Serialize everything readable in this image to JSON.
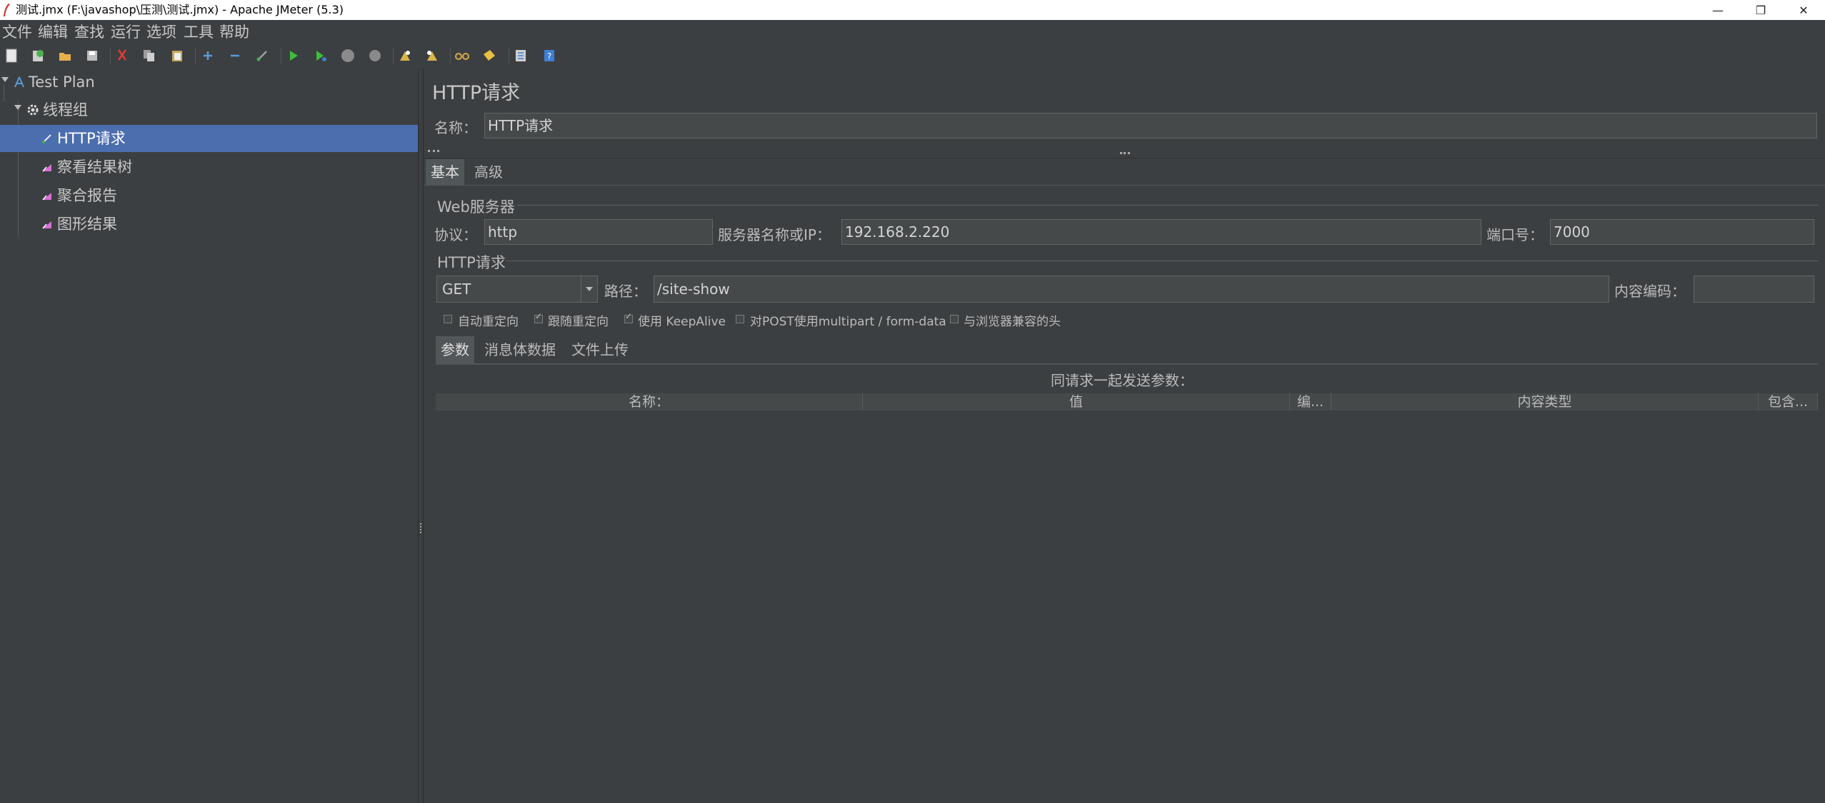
{
  "window": {
    "title": "测试.jmx (F:\\javashop\\压测\\测试.jmx) - Apache JMeter (5.3)",
    "minimize": "—",
    "restore": "❐",
    "close": "✕"
  },
  "menu": [
    "文件",
    "编辑",
    "查找",
    "运行",
    "选项",
    "工具",
    "帮助"
  ],
  "toolbar": [
    {
      "icon": "new-icon",
      "color": "#e0e0e0"
    },
    {
      "icon": "templates-icon",
      "color": "#4caf50"
    },
    {
      "icon": "open-icon",
      "color": "#e8b04a"
    },
    {
      "icon": "save-icon",
      "color": "#cccccc"
    },
    {
      "icon": "cut-icon",
      "color": "#e53935"
    },
    {
      "icon": "copy-icon",
      "color": "#cccccc"
    },
    {
      "icon": "paste-icon",
      "color": "#e8c86a"
    },
    {
      "icon": "expand-icon",
      "color": "#5b9bd5"
    },
    {
      "icon": "collapse-icon",
      "color": "#5b9bd5"
    },
    {
      "icon": "toggle-icon",
      "color": "#9e9e9e"
    },
    {
      "icon": "start-icon",
      "color": "#3cbd3c"
    },
    {
      "icon": "start-no-pause-icon",
      "color": "#3cbd3c"
    },
    {
      "icon": "stop-icon",
      "color": "#8a8a8a"
    },
    {
      "icon": "shutdown-icon",
      "color": "#8a8a8a"
    },
    {
      "icon": "clear-icon",
      "color": "#d9b44a"
    },
    {
      "icon": "clear-all-icon",
      "color": "#d9b44a"
    },
    {
      "icon": "search-icon",
      "color": "#d4a84a"
    },
    {
      "icon": "reset-search-icon",
      "color": "#e8c040"
    },
    {
      "icon": "function-helper-icon",
      "color": "#cccccc"
    },
    {
      "icon": "help-icon",
      "color": "#3d7ed6"
    }
  ],
  "tree": [
    {
      "label": "Test Plan",
      "icon": "test-plan-icon",
      "level": 0,
      "expanded": true
    },
    {
      "label": "线程组",
      "icon": "thread-group-icon",
      "level": 1,
      "expanded": true
    },
    {
      "label": "HTTP请求",
      "icon": "sampler-icon",
      "level": 2,
      "selected": true
    },
    {
      "label": "察看结果树",
      "icon": "listener-icon",
      "level": 2
    },
    {
      "label": "聚合报告",
      "icon": "listener-icon",
      "level": 2
    },
    {
      "label": "图形结果",
      "icon": "listener-icon",
      "level": 2
    }
  ],
  "panel": {
    "title": "HTTP请求",
    "name_label": "名称：",
    "name_value": "HTTP请求",
    "tabs": [
      "基本",
      "高级"
    ],
    "web_server_label": "Web服务器",
    "protocol_label": "协议：",
    "protocol_value": "http",
    "server_label": "服务器名称或IP：",
    "server_value": "192.168.2.220",
    "port_label": "端口号：",
    "port_value": "7000",
    "http_request_label": "HTTP请求",
    "method_value": "GET",
    "path_label": "路径：",
    "path_value": "/site-show",
    "encoding_label": "内容编码：",
    "encoding_value": "",
    "checkboxes": [
      {
        "label": "自动重定向",
        "checked": false
      },
      {
        "label": "跟随重定向",
        "checked": true
      },
      {
        "label": "使用 KeepAlive",
        "checked": true
      },
      {
        "label": "对POST使用multipart / form-data",
        "checked": false
      },
      {
        "label": "与浏览器兼容的头",
        "checked": false
      }
    ],
    "subtabs": [
      "参数",
      "消息体数据",
      "文件上传"
    ],
    "params_caption": "同请求一起发送参数：",
    "columns": [
      "名称：",
      "值",
      "编...",
      "内容类型",
      "包含..."
    ]
  },
  "colors": {
    "selection": "#4b6eaf",
    "background": "#3c3f41",
    "field": "#45494a"
  }
}
